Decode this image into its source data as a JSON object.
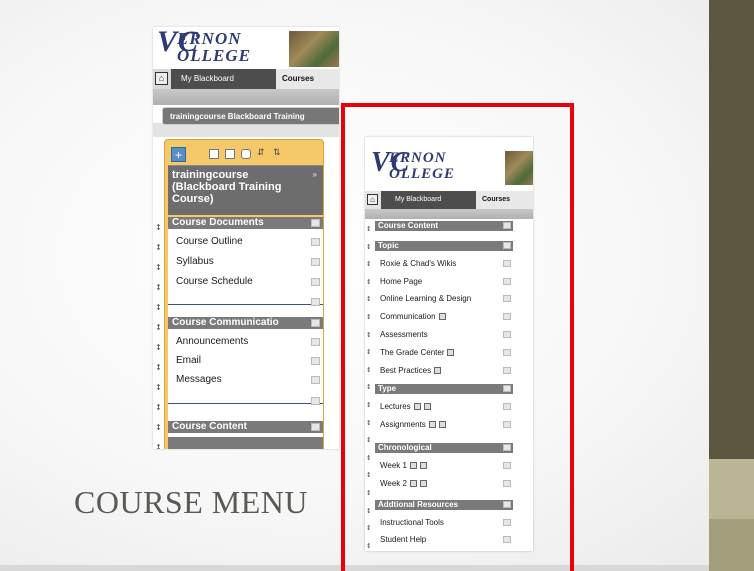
{
  "slide": {
    "title": "COURSE MENU",
    "colors": {
      "band_dark": "#5c5741",
      "band_light": "#bcb595",
      "frame": "#e8000a",
      "menu_header": "#7a7a7a"
    }
  },
  "left_panel": {
    "logo_line1": "ERNON",
    "logo_line2": "OLLEGE",
    "logo_initials": "VC",
    "tabs": {
      "my_blackboard": "My Blackboard",
      "courses": "Courses"
    },
    "breadcrumb": "trainingcourse Blackboard Training",
    "course_title": "trainingcourse (Blackboard Training Course)",
    "course_arrow": "»",
    "toolbar_icons": [
      "plus-icon",
      "folder-icon",
      "page-icon",
      "chat-icon",
      "refresh-icon",
      "sort-icon"
    ],
    "sections": [
      {
        "header": "Course Documents",
        "items": [
          "Course Outline",
          "Syllabus",
          "Course Schedule"
        ]
      },
      {
        "header": "Course Communicatio",
        "items": [
          "Announcements",
          "Email",
          "Messages"
        ]
      },
      {
        "header": "Course Content",
        "items": []
      }
    ]
  },
  "right_panel": {
    "logo_line1": "ERNON",
    "logo_line2": "OLLEGE",
    "logo_initials": "VC",
    "tabs": {
      "my_blackboard": "My Blackboard",
      "courses": "Courses"
    },
    "sections": [
      {
        "header": "Course Content",
        "items": []
      },
      {
        "header": "Topic",
        "items": [
          "Roxie & Chad's Wikis",
          "Home Page",
          "Online Learning & Design",
          "Communication",
          "Assessments",
          "The Grade Center",
          "Best Practices"
        ]
      },
      {
        "header": "Type",
        "items": [
          "Lectures",
          "Assignments"
        ]
      },
      {
        "header": "Chronological",
        "items": [
          "Week 1",
          "Week 2"
        ]
      },
      {
        "header": "Addtional Resources",
        "items": [
          "Instructional Tools",
          "Student Help"
        ]
      }
    ]
  }
}
